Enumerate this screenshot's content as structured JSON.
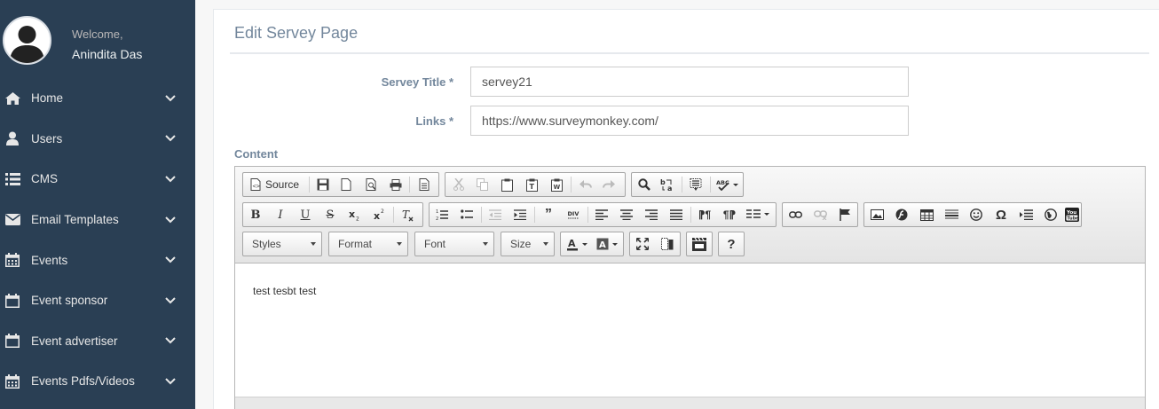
{
  "profile": {
    "welcome": "Welcome,",
    "name": "Anindita Das"
  },
  "sidebar": {
    "items": [
      {
        "label": "Home",
        "icon": "home-icon"
      },
      {
        "label": "Users",
        "icon": "user-icon"
      },
      {
        "label": "CMS",
        "icon": "list-icon"
      },
      {
        "label": "Email Templates",
        "icon": "envelope-icon"
      },
      {
        "label": "Events",
        "icon": "calendar-icon"
      },
      {
        "label": "Event sponsor",
        "icon": "calendar-empty-icon"
      },
      {
        "label": "Event advertiser",
        "icon": "calendar-empty-icon"
      },
      {
        "label": "Events Pdfs/Videos",
        "icon": "calendar-icon"
      }
    ]
  },
  "page": {
    "title": "Edit Servey Page"
  },
  "form": {
    "title_label": "Servey Title *",
    "title_value": "servey21",
    "links_label": "Links *",
    "links_value": "https://www.surveymonkey.com/",
    "content_label": "Content"
  },
  "editor": {
    "source_label": "Source",
    "styles_label": "Styles",
    "format_label": "Format",
    "font_label": "Font",
    "size_label": "Size",
    "body_text": "test tesbt test"
  },
  "colors": {
    "sidebar_bg": "#2a3f54",
    "label_color": "#73879c"
  }
}
